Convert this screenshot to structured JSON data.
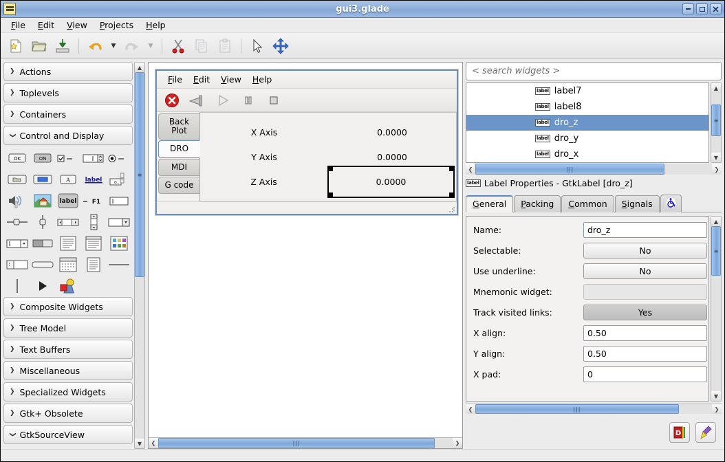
{
  "window": {
    "title": "gui3.glade",
    "icon": "glade-window-icon",
    "controls": {
      "minimize": "–",
      "maximize": "□",
      "close": "✕"
    }
  },
  "menubar": [
    {
      "label": "File",
      "mnemonic": "F"
    },
    {
      "label": "Edit",
      "mnemonic": "E"
    },
    {
      "label": "View",
      "mnemonic": "V"
    },
    {
      "label": "Projects",
      "mnemonic": "P"
    },
    {
      "label": "Help",
      "mnemonic": "H"
    }
  ],
  "toolbar": [
    {
      "name": "new-project-button",
      "icon": "new-document-icon",
      "enabled": true
    },
    {
      "name": "open-project-button",
      "icon": "open-folder-icon",
      "enabled": true
    },
    {
      "name": "save-project-button",
      "icon": "save-disk-icon",
      "enabled": true
    },
    {
      "name": "undo-button",
      "icon": "undo-arrow-icon",
      "enabled": true
    },
    {
      "name": "undo-dropdown-button",
      "icon": "chevron-down-icon",
      "enabled": true
    },
    {
      "name": "redo-button",
      "icon": "redo-arrow-icon",
      "enabled": false
    },
    {
      "name": "redo-dropdown-button",
      "icon": "chevron-down-icon",
      "enabled": false
    },
    {
      "name": "cut-button",
      "icon": "scissors-icon",
      "enabled": true
    },
    {
      "name": "copy-button",
      "icon": "copy-pages-icon",
      "enabled": false
    },
    {
      "name": "paste-button",
      "icon": "clipboard-icon",
      "enabled": false
    },
    {
      "name": "select-pointer-button",
      "icon": "mouse-pointer-icon",
      "enabled": true
    },
    {
      "name": "drag-resize-button",
      "icon": "move-arrows-icon",
      "enabled": true
    }
  ],
  "palette": {
    "categories": [
      {
        "label": "Actions",
        "expanded": false
      },
      {
        "label": "Toplevels",
        "expanded": false
      },
      {
        "label": "Containers",
        "expanded": false
      },
      {
        "label": "Control and Display",
        "expanded": true
      }
    ],
    "widgets": [
      "button-ok-icon",
      "toggle-button-on-icon",
      "check-button-icon",
      "spin-button-icon",
      "radio-button-icon",
      "file-chooser-button-icon",
      "color-button-icon",
      "font-button-icon",
      "link-button-icon",
      "scale-button-icon",
      "volume-button-icon",
      "image-icon",
      "label-icon",
      "accel-label-icon",
      "entry-icon",
      "horizontal-scale-icon",
      "vertical-scale-icon",
      "horizontal-scrollbar-icon",
      "vertical-scrollbar-icon",
      "combo-box-icon",
      "combo-box-entry-icon",
      "switch-icon",
      "text-view-icon",
      "tree-view-icon",
      "icon-view-icon",
      "list-box-icon",
      "level-bar-icon",
      "calendar-icon",
      "list-store-icon",
      "separator-icon",
      "vertical-separator-icon",
      "arrow-icon",
      "drawing-area-icon"
    ],
    "categories_bottom": [
      {
        "label": "Composite Widgets",
        "expanded": false
      },
      {
        "label": "Tree Model",
        "expanded": false
      },
      {
        "label": "Text Buffers",
        "expanded": false
      },
      {
        "label": "Miscellaneous",
        "expanded": false
      },
      {
        "label": "Specialized Widgets",
        "expanded": false
      },
      {
        "label": "Gtk+ Obsolete",
        "expanded": false
      },
      {
        "label": "GtkSourceView",
        "expanded": true
      }
    ]
  },
  "design": {
    "menubar": [
      "File",
      "Edit",
      "View",
      "Help"
    ],
    "toolbar": [
      {
        "name": "estop-button",
        "icon": "red-stop-circle-icon"
      },
      {
        "name": "machine-power-button",
        "icon": "power-switch-icon"
      },
      {
        "name": "run-button",
        "icon": "play-triangle-icon"
      },
      {
        "name": "pause-button",
        "icon": "pause-bars-icon"
      },
      {
        "name": "stop-button",
        "icon": "stop-square-icon"
      }
    ],
    "tabs": [
      {
        "label": "Back Plot",
        "active": false
      },
      {
        "label": "DRO",
        "active": true
      },
      {
        "label": "MDI",
        "active": false
      },
      {
        "label": "G code",
        "active": false
      }
    ],
    "axes": [
      {
        "label": "X Axis",
        "value": "0.0000",
        "selected": false
      },
      {
        "label": "Y Axis",
        "value": "0.0000",
        "selected": false
      },
      {
        "label": "Z Axis",
        "value": "0.0000",
        "selected": true
      }
    ]
  },
  "inspector": {
    "search": {
      "placeholder": "< search widgets >",
      "value": ""
    },
    "tree": [
      {
        "icon": "label-widget-icon",
        "label": "label7",
        "selected": false
      },
      {
        "icon": "label-widget-icon",
        "label": "label8",
        "selected": false
      },
      {
        "icon": "label-widget-icon",
        "label": "dro_z",
        "selected": true
      },
      {
        "icon": "label-widget-icon",
        "label": "dro_y",
        "selected": false
      },
      {
        "icon": "label-widget-icon",
        "label": "dro_x",
        "selected": false
      }
    ],
    "properties_title": "Label Properties - GtkLabel [dro_z]",
    "properties_title_icon": "label-widget-icon",
    "tabs": [
      {
        "label": "General",
        "mnemonic": "G",
        "active": true
      },
      {
        "label": "Packing",
        "mnemonic": "P",
        "active": false
      },
      {
        "label": "Common",
        "mnemonic": "C",
        "active": false
      },
      {
        "label": "Signals",
        "mnemonic": "S",
        "active": false
      }
    ],
    "a11y_tab_icon": "accessibility-wheelchair-icon",
    "properties": [
      {
        "name": "Name:",
        "value": "dro_z",
        "type": "text",
        "disabled": false
      },
      {
        "name": "Selectable:",
        "value": "No",
        "type": "toggle",
        "on": false,
        "disabled": false
      },
      {
        "name": "Use underline:",
        "value": "No",
        "type": "toggle",
        "on": false,
        "disabled": false
      },
      {
        "name": "Mnemonic widget:",
        "value": "",
        "type": "toggle",
        "on": false,
        "disabled": true
      },
      {
        "name": "Track visited links:",
        "value": "Yes",
        "type": "toggle",
        "on": true,
        "disabled": false
      },
      {
        "name": "X align:",
        "value": "0.50",
        "type": "text",
        "disabled": false
      },
      {
        "name": "Y align:",
        "value": "0.50",
        "type": "text",
        "disabled": false
      },
      {
        "name": "X pad:",
        "value": "0",
        "type": "text",
        "disabled": false
      }
    ],
    "bottom_buttons": [
      {
        "name": "documentation-button",
        "icon": "devhelp-book-icon"
      },
      {
        "name": "clear-properties-button",
        "icon": "broom-icon"
      }
    ]
  },
  "colors": {
    "titlebar": "#8fb0da",
    "selection": "#6b95c9",
    "scrollbar_thumb": "#7ba7da",
    "background": "#ececec",
    "accent_tab": "#5d8ac4"
  }
}
